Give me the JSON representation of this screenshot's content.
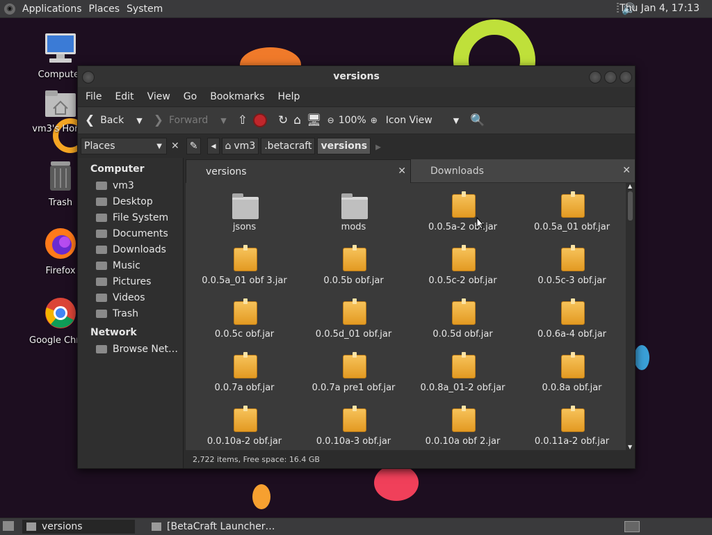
{
  "top_panel": {
    "logo_icon": "distro-logo-icon",
    "menus": [
      "Applications",
      "Places",
      "System"
    ],
    "volume_icon": "speaker-icon",
    "clock": "Thu Jan  4, 17:13"
  },
  "desktop": {
    "icons": [
      {
        "label": "Computer",
        "icon": "computer-icon"
      },
      {
        "label": "vm3's Home",
        "icon": "home-folder-icon"
      },
      {
        "label": "Trash",
        "icon": "trash-icon"
      },
      {
        "label": "Firefox",
        "icon": "firefox-icon"
      },
      {
        "label": "Google Chrome",
        "icon": "chrome-icon"
      }
    ]
  },
  "window": {
    "title": "versions",
    "menu": [
      "File",
      "Edit",
      "View",
      "Go",
      "Bookmarks",
      "Help"
    ],
    "toolbar": {
      "back": "Back",
      "forward": "Forward",
      "zoom": "100%",
      "view_mode": "Icon View"
    },
    "places_combo": "Places",
    "breadcrumb": [
      "vm3",
      ".betacraft",
      "versions"
    ],
    "sidebar": {
      "sections": [
        {
          "heading": "Computer",
          "items": [
            "vm3",
            "Desktop",
            "File System",
            "Documents",
            "Downloads",
            "Music",
            "Pictures",
            "Videos",
            "Trash"
          ]
        },
        {
          "heading": "Network",
          "items": [
            "Browse Net…"
          ]
        }
      ]
    },
    "tabs": [
      {
        "label": "versions",
        "active": true
      },
      {
        "label": "Downloads",
        "active": false
      }
    ],
    "files": [
      {
        "name": "jsons",
        "type": "folder"
      },
      {
        "name": "mods",
        "type": "folder"
      },
      {
        "name": "0.0.5a-2 obf.jar",
        "type": "jar"
      },
      {
        "name": "0.0.5a_01 obf.jar",
        "type": "jar"
      },
      {
        "name": "0.0.5a_01 obf 3.jar",
        "type": "jar"
      },
      {
        "name": "0.0.5b obf.jar",
        "type": "jar"
      },
      {
        "name": "0.0.5c-2 obf.jar",
        "type": "jar"
      },
      {
        "name": "0.0.5c-3 obf.jar",
        "type": "jar"
      },
      {
        "name": "0.0.5c obf.jar",
        "type": "jar"
      },
      {
        "name": "0.0.5d_01 obf.jar",
        "type": "jar"
      },
      {
        "name": "0.0.5d obf.jar",
        "type": "jar"
      },
      {
        "name": "0.0.6a-4 obf.jar",
        "type": "jar"
      },
      {
        "name": "0.0.7a obf.jar",
        "type": "jar"
      },
      {
        "name": "0.0.7a pre1 obf.jar",
        "type": "jar"
      },
      {
        "name": "0.0.8a_01-2 obf.jar",
        "type": "jar"
      },
      {
        "name": "0.0.8a obf.jar",
        "type": "jar"
      },
      {
        "name": "0.0.10a-2 obf.jar",
        "type": "jar"
      },
      {
        "name": "0.0.10a-3 obf.jar",
        "type": "jar"
      },
      {
        "name": "0.0.10a obf 2.jar",
        "type": "jar"
      },
      {
        "name": "0.0.11a-2 obf.jar",
        "type": "jar"
      }
    ],
    "status": "2,722 items, Free space: 16.4 GB"
  },
  "taskbar": {
    "tasks": [
      {
        "label": "versions",
        "active": true
      },
      {
        "label": "[BetaCraft Launcher…",
        "active": false
      }
    ]
  }
}
